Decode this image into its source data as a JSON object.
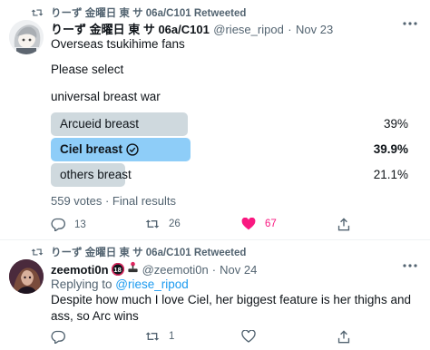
{
  "tweet1": {
    "retweeted_by": "りーず 金曜日 東 サ 06a/C101 Retweeted",
    "author_name": "りーず 金曜日 東 サ 06a/C101",
    "author_handle": "@riese_ripod",
    "separator": "·",
    "date": "Nov 23",
    "lines": [
      "Overseas tsukihime fans",
      "Please select",
      "universal breast war"
    ],
    "poll": [
      {
        "label": "Arcueid breast",
        "percent": "39%",
        "fraction": 0.39,
        "winner": false
      },
      {
        "label": "Ciel breast",
        "percent": "39.9%",
        "fraction": 0.399,
        "winner": true
      },
      {
        "label": "others breast",
        "percent": "21.1%",
        "fraction": 0.211,
        "winner": false
      }
    ],
    "poll_footer": "559 votes · Final results",
    "replies": "13",
    "retweets": "26",
    "likes": "67"
  },
  "tweet2": {
    "retweeted_by": "りーず 金曜日 東 サ 06a/C101 Retweeted",
    "author_name": "zeemoti0n",
    "author_handle": "@zeemoti0n",
    "separator": "·",
    "date": "Nov 24",
    "badge_text": "18",
    "reply_prefix": "Replying to ",
    "reply_to": "@riese_ripod",
    "text": "Despite how much I love Ciel, her biggest feature is her thighs and ass, so Arc wins",
    "retweets": "1"
  },
  "colors": {
    "accent": "#1d9bf0",
    "winner_bar": "#8ecdf8",
    "loser_bar": "#cfd9de",
    "like_pink": "#f91880",
    "muted": "#536471"
  }
}
